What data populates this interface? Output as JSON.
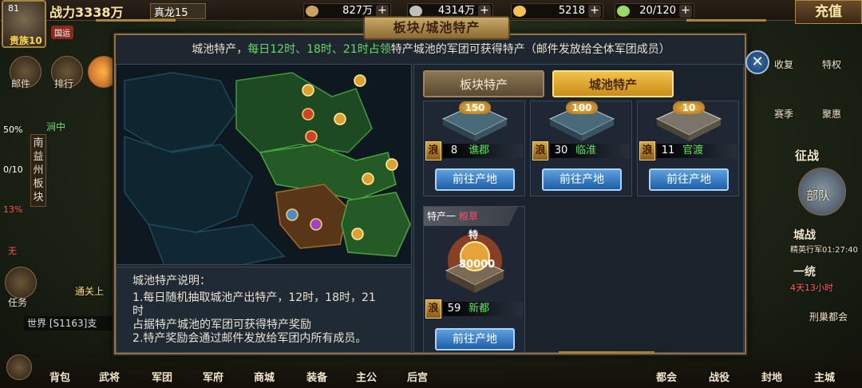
{
  "hud": {
    "level": "81",
    "vip": "贵族10",
    "power": "战力3338万",
    "guoyun": "国运",
    "team_name": "真龙15",
    "resources": [
      {
        "name": "grain",
        "value": "827万",
        "color": "#c9a35a"
      },
      {
        "name": "silver",
        "value": "4314万",
        "color": "#bfbfbf"
      },
      {
        "name": "gold",
        "value": "5218",
        "color": "#f2c14e"
      },
      {
        "name": "stamina",
        "value": "20/120",
        "color": "#9bd86a"
      }
    ],
    "recharge": "充值",
    "left_labels": [
      "邮件",
      "排行",
      "涧中",
      "任务"
    ],
    "vertical_text": "南益州板块",
    "percents": [
      "50%",
      "0/10",
      "13%",
      "无"
    ],
    "chat": "世界 [S1163]支",
    "right_labels": [
      "收复",
      "特权",
      "赛季",
      "聚惠",
      "征战",
      "部队",
      "城战",
      "一统",
      "刑巢都会"
    ],
    "timer1": "精英行军01:27:40",
    "timer2": "4天13小时",
    "tongguan": "通关上",
    "bottom": [
      "背包",
      "武将",
      "军团",
      "军府",
      "商城",
      "装备",
      "主公",
      "后宫",
      "都会",
      "战役",
      "封地",
      "主城"
    ]
  },
  "modal": {
    "title": "板块/城池特产",
    "notice_pre": "城池特产，",
    "notice_hl": "每日12时、18时、21时占领",
    "notice_post": "特产城池的军团可获得特产（邮件发放给全体军团成员）",
    "close": "✕",
    "tabs": [
      "板块特产",
      "城池特产"
    ],
    "desc_title": "城池特产说明：",
    "desc_lines": [
      "1.每日随机抽取城池产出特产，12时，18时，21",
      "时",
      "占据特产城池的军团可获得特产奖励",
      "2.特产奖励会通过邮件发放给军团内所有成员。"
    ],
    "cards": [
      {
        "count": "150",
        "tag": "浪",
        "num": "8",
        "city": "谯郡",
        "button": "前往产地"
      },
      {
        "count": "100",
        "tag": "浪",
        "num": "30",
        "city": "临淮",
        "button": "前往产地"
      },
      {
        "count": "10",
        "tag": "浪",
        "num": "11",
        "city": "官渡",
        "button": "前往产地"
      }
    ],
    "special_card": {
      "header_pre": "特产一 ",
      "header_item": "粮草",
      "te": "特",
      "amount": "80000",
      "tag": "浪",
      "num": "59",
      "city": "新都",
      "button": "前往产地"
    }
  }
}
